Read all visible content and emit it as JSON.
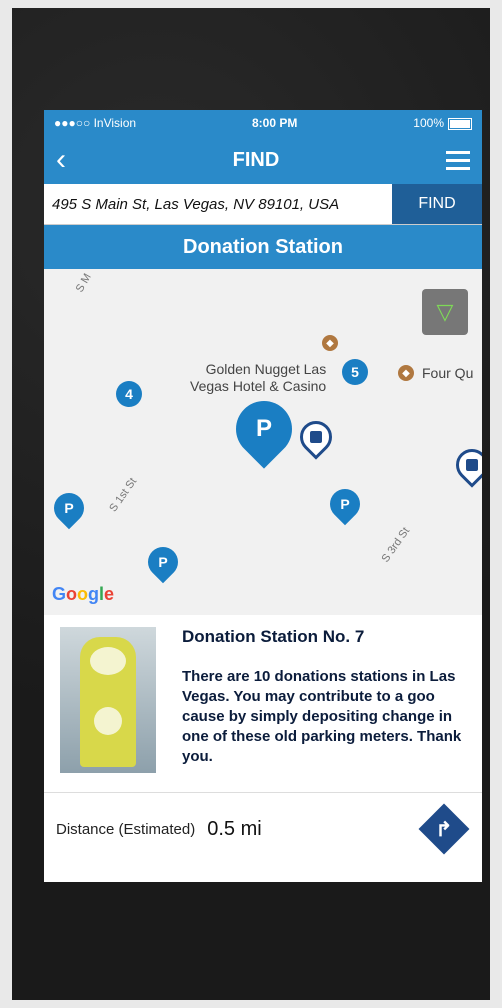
{
  "status_bar": {
    "carrier": "●●●○○ InVision",
    "time": "8:00 PM",
    "battery": "100%"
  },
  "navbar": {
    "back_icon": "chevron-left-icon",
    "title": "FIND",
    "menu_icon": "hamburger-icon"
  },
  "search": {
    "address": "495 S Main St, Las Vegas, NV 89101, USA",
    "find_label": "FIND"
  },
  "banner": {
    "title": "Donation Station"
  },
  "map": {
    "roads": [
      "S M",
      "S 1st St",
      "S 3rd St"
    ],
    "poi_label": "Golden Nugget Las Vegas Hotel & Casino",
    "poi_label_line2": "Vegas Hotel & Casino",
    "poi_label_line1": "Golden Nugget Las",
    "four_q": "Four Qu",
    "clusters": [
      "4",
      "5"
    ],
    "pin_label": "P",
    "attribution": "Google"
  },
  "station": {
    "title": "Donation Station No. 7",
    "description": "There are 10 donations stations in Las Vegas. You may contribute to a goo cause by simply depositing change in one of these old parking meters. Thank you."
  },
  "distance": {
    "label": "Distance (Estimated)",
    "value": "0.5 mi"
  }
}
